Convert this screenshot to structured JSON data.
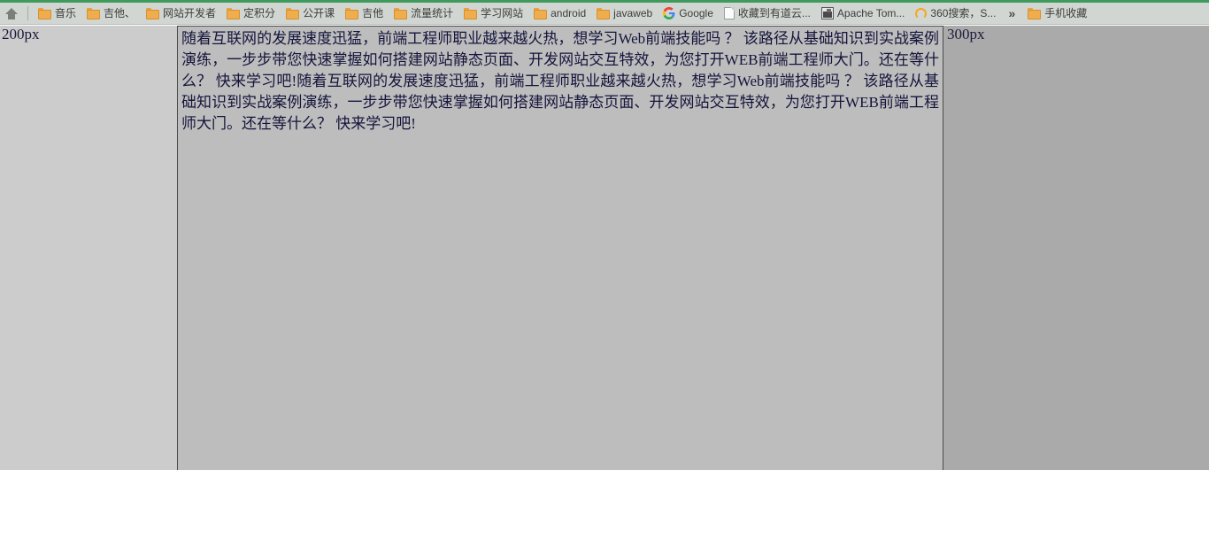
{
  "browser": {
    "accent_color": "#3f9b5c",
    "bookmark_bar": {
      "home_icon": "home-icon",
      "overflow_label": "»",
      "items": [
        {
          "icon": "folder-icon",
          "label": "音乐"
        },
        {
          "icon": "folder-icon",
          "label": "吉他、"
        },
        {
          "icon": "folder-icon",
          "label": "网站开发者"
        },
        {
          "icon": "folder-icon",
          "label": "定积分"
        },
        {
          "icon": "folder-icon",
          "label": "公开课"
        },
        {
          "icon": "folder-icon",
          "label": "吉他"
        },
        {
          "icon": "folder-icon",
          "label": "流量统计"
        },
        {
          "icon": "folder-icon",
          "label": "学习网站"
        },
        {
          "icon": "folder-icon",
          "label": "android"
        },
        {
          "icon": "folder-icon",
          "label": "javaweb"
        },
        {
          "icon": "google-icon",
          "label": "Google"
        },
        {
          "icon": "page-icon",
          "label": "收藏到有道云..."
        },
        {
          "icon": "tomcat-icon",
          "label": "Apache Tom..."
        },
        {
          "icon": "360-icon",
          "label": "360搜索，S..."
        }
      ],
      "overflow_items": [
        {
          "icon": "folder-icon",
          "label": "手机收藏"
        }
      ]
    }
  },
  "page": {
    "left_panel": {
      "width_label": "200px",
      "background": "#cccccc"
    },
    "right_panel": {
      "width_label": "300px",
      "background": "#aaaaaa"
    },
    "content_panel": {
      "background": "#bdbdbd",
      "border_color": "#4b4b4b",
      "paragraph": "随着互联网的发展速度迅猛，前端工程师职业越来越火热，想学习Web前端技能吗 ？ 该路径从基础知识到实战案例演练，一步步带您快速掌握如何搭建网站静态页面、开发网站交互特效，为您打开WEB前端工程师大门。还在等什么？ 快来学习吧!随着互联网的发展速度迅猛，前端工程师职业越来越火热，想学习Web前端技能吗 ？ 该路径从基础知识到实战案例演练，一步步带您快速掌握如何搭建网站静态页面、开发网站交互特效，为您打开WEB前端工程师大门。还在等什么？ 快来学习吧!"
    }
  }
}
